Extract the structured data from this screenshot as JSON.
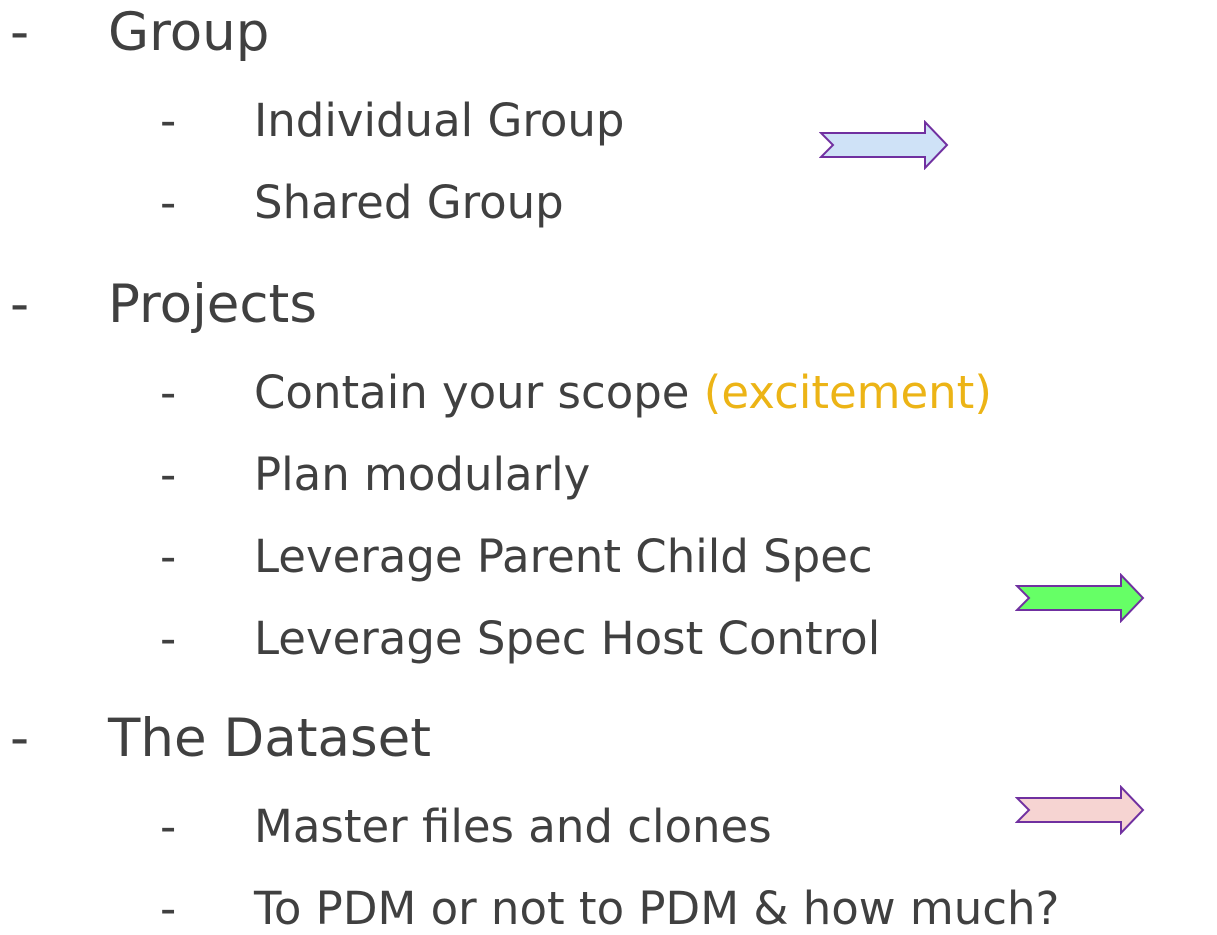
{
  "bullet_marker": "-",
  "sections": [
    {
      "title": "Group",
      "items": [
        {
          "text": "Individual Group",
          "highlight": ""
        },
        {
          "text": "Shared Group",
          "highlight": ""
        }
      ]
    },
    {
      "title": "Projects",
      "items": [
        {
          "text": "Contain your scope ",
          "highlight": "(excitement)"
        },
        {
          "text": "Plan modularly",
          "highlight": ""
        },
        {
          "text": "Leverage Parent Child Spec",
          "highlight": ""
        },
        {
          "text": "Leverage Spec Host Control",
          "highlight": ""
        }
      ]
    },
    {
      "title": "The Dataset",
      "items": [
        {
          "text": "Master files and clones",
          "highlight": ""
        },
        {
          "text": "To PDM or not to PDM & how much?",
          "highlight": ""
        }
      ]
    }
  ],
  "colors": {
    "text": "#404040",
    "highlight": "#ecb416",
    "arrow_outline": "#7030a0",
    "arrow_fill_1": "#cfe2f7",
    "arrow_fill_2": "#66ff66",
    "arrow_fill_3": "#f6d4d2"
  },
  "arrows": [
    {
      "icon": "right-arrow-icon",
      "fill": "#cfe2f7"
    },
    {
      "icon": "right-arrow-icon",
      "fill": "#66ff66"
    },
    {
      "icon": "right-arrow-icon",
      "fill": "#f6d4d2"
    }
  ]
}
